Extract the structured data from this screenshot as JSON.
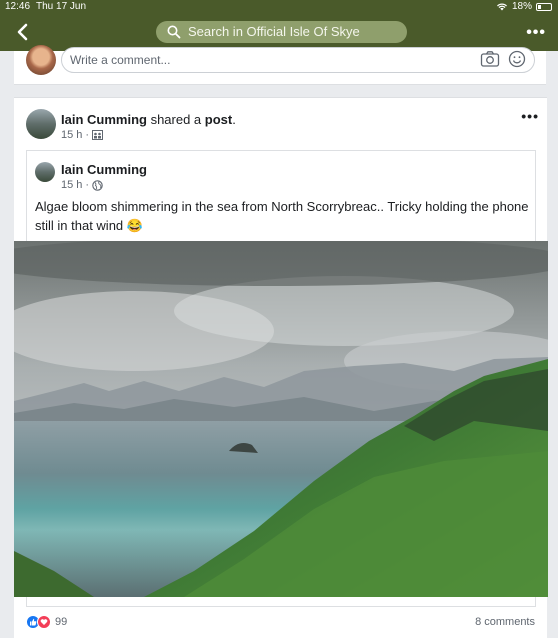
{
  "status_bar": {
    "time": "12:46",
    "date": "Thu 17 Jun",
    "battery": "18%"
  },
  "nav": {
    "search_placeholder": "Search in Official Isle Of Skye",
    "more_label": "•••"
  },
  "comment_box": {
    "placeholder": "Write a comment..."
  },
  "post": {
    "author": "Iain Cumming",
    "action_text": " shared a ",
    "object_text": "post",
    "trailing": ".",
    "time": "15 h",
    "more_label": "•••",
    "shared": {
      "author": "Iain Cumming",
      "time": "15 h",
      "text": "Algae bloom shimmering in the sea from North Scorrybreac.. Tricky holding the phone still in that wind 😂"
    },
    "reactions_count": "99",
    "comments_label": "8 comments"
  }
}
